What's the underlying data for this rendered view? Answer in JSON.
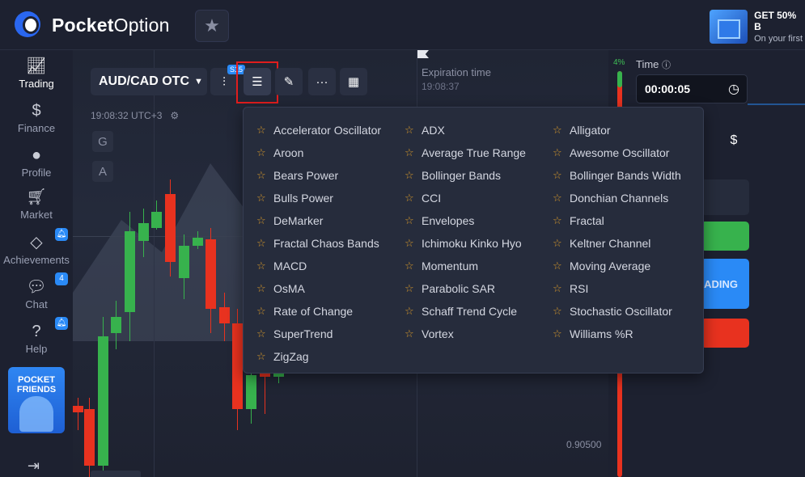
{
  "brand": {
    "name_bold": "Pocket",
    "name_light": "Option"
  },
  "promo": {
    "title": "GET 50% B",
    "subtitle": "On your first"
  },
  "nav": {
    "items": [
      {
        "label": "Trading",
        "icon": "chart-line-icon"
      },
      {
        "label": "Finance",
        "icon": "dollar-icon"
      },
      {
        "label": "Profile",
        "icon": "user-icon"
      },
      {
        "label": "Market",
        "icon": "cart-icon"
      },
      {
        "label": "Achievements",
        "icon": "diamond-icon"
      },
      {
        "label": "Chat",
        "icon": "chat-icon",
        "badge": "4"
      },
      {
        "label": "Help",
        "icon": "help-icon"
      }
    ],
    "friends_banner": "POCKET\nFRIENDS"
  },
  "chart": {
    "pair": "AUD/CAD OTC",
    "time": "19:08:32 UTC+3",
    "timeframe_badge": "S15",
    "side_buttons": [
      "G",
      "A"
    ],
    "expiration_label": "Expiration time",
    "expiration_value": "19:08:37",
    "price_level": "0.90500"
  },
  "progress": {
    "percent": "4%"
  },
  "panel": {
    "time_label": "Time",
    "time_value": "00:00:05",
    "trade_button_fragment": "ADING"
  },
  "indicators": {
    "columns": [
      [
        "Accelerator Oscillator",
        "Aroon",
        "Bears Power",
        "Bulls Power",
        "DeMarker",
        "Fractal Chaos Bands",
        "MACD",
        "OsMA",
        "Rate of Change",
        "SuperTrend",
        "ZigZag"
      ],
      [
        "ADX",
        "Average True Range",
        "Bollinger Bands",
        "CCI",
        "Envelopes",
        "Ichimoku Kinko Hyo",
        "Momentum",
        "Parabolic SAR",
        "Schaff Trend Cycle",
        "Vortex"
      ],
      [
        "Alligator",
        "Awesome Oscillator",
        "Bollinger Bands Width",
        "Donchian Channels",
        "Fractal",
        "Keltner Channel",
        "Moving Average",
        "RSI",
        "Stochastic Oscillator",
        "Williams %R"
      ]
    ]
  },
  "colors": {
    "accent": "#2a8af6",
    "up": "#37b24d",
    "down": "#e8321f",
    "highlight": "#e01d1d"
  }
}
